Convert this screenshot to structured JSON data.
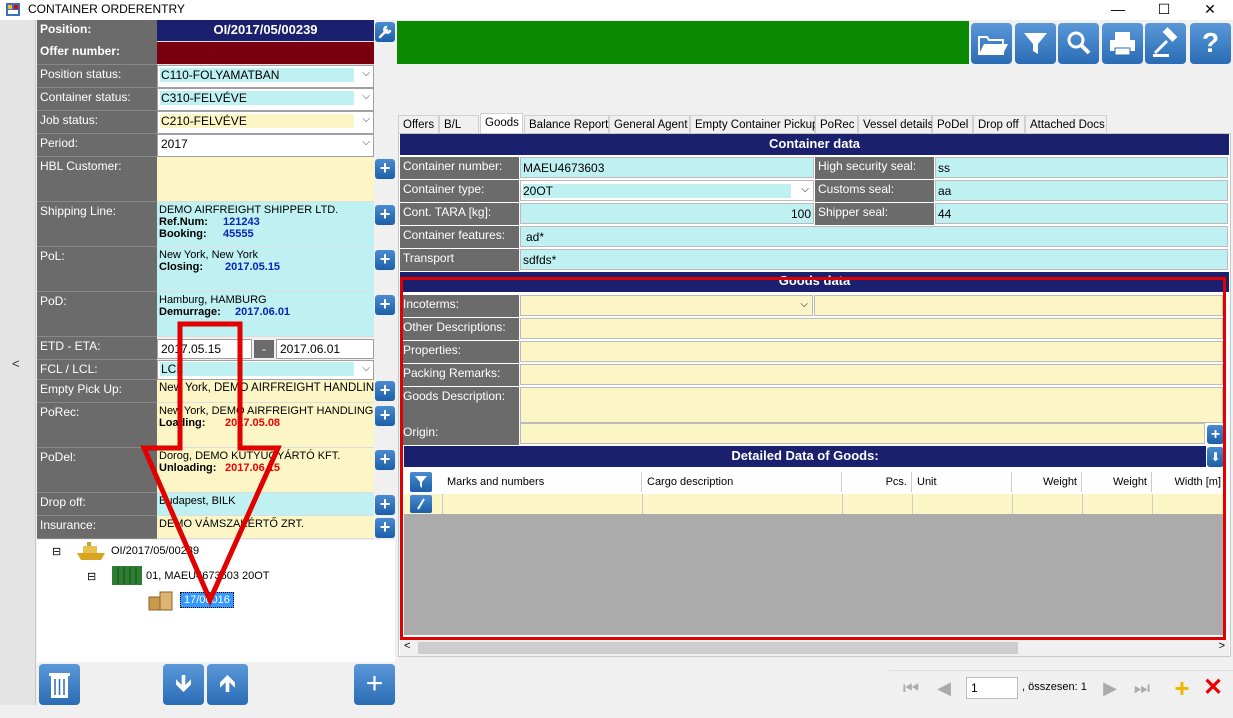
{
  "window": {
    "title": "CONTAINER ORDERENTRY",
    "minimize": "—",
    "maximize": "☐",
    "close": "✕"
  },
  "left": {
    "collapse_label": "<",
    "position_label": "Position:",
    "position_value": "OI/2017/05/00239",
    "offer_label": "Offer number:",
    "position_status_label": "Position status:",
    "position_status_value": "C110-FOLYAMATBAN",
    "container_status_label": "Container status:",
    "container_status_value": "C310-FELVÉVE",
    "job_status_label": "Job status:",
    "job_status_value": "C210-FELVÉVE",
    "period_label": "Period:",
    "period_value": "2017",
    "hbl_label": "HBL Customer:",
    "shipping_line_label": "Shipping Line:",
    "shipping_line_name": "DEMO AIRFREIGHT SHIPPER LTD.",
    "ref_label": "Ref.Num:",
    "ref_value": "121243",
    "booking_label": "Booking:",
    "booking_value": "45555",
    "pol_label": "PoL:",
    "pol_place": "New York, New York",
    "closing_label": "Closing:",
    "closing_value": "2017.05.15",
    "pod_label": "PoD:",
    "pod_place": "Hamburg, HAMBURG",
    "demurrage_label": "Demurrage:",
    "demurrage_value": "2017.06.01",
    "etd_label": "ETD - ETA:",
    "etd_value": "2017.05.15",
    "eta_sep": "-",
    "eta_value": "2017.06.01",
    "fcl_label": "FCL / LCL:",
    "fcl_value": "LCL",
    "empty_pickup_label": "Empty Pick Up:",
    "empty_pickup_value": "New York, DEMO AIRFREIGHT HANDLING A",
    "porec_label": "PoRec:",
    "porec_value": "New York, DEMO AIRFREIGHT HANDLING AG",
    "loading_label": "Loading:",
    "loading_value": "2017.05.08",
    "podel_label": "PoDel:",
    "podel_value": "Dorog, DEMO KÜTYÜGYÁRTÓ KFT.",
    "unloading_label": "Unloading:",
    "unloading_value": "2017.06.15",
    "dropoff_label": "Drop off:",
    "dropoff_value": "Budapest, BILK",
    "insurance_label": "Insurance:",
    "insurance_value": "DEMO VÁMSZAKÉRTŐ ZRT.",
    "tree": {
      "root": "OI/2017/05/00239",
      "child": "01, MAEU4673603 20OT",
      "leaf": "17/00016"
    }
  },
  "tabs": [
    "Offers",
    "B/L",
    "Goods",
    "Balance Report",
    "General Agent",
    "Empty Container Pickup",
    "PoRec",
    "Vessel details",
    "PoDel",
    "Drop off",
    "Attached Docs"
  ],
  "active_tab": "Goods",
  "container": {
    "header": "Container data",
    "number_label": "Container number:",
    "number_value": "MAEU4673603",
    "type_label": "Container type:",
    "type_value": "20OT",
    "tara_label": "Cont. TARA [kg]:",
    "tara_value": "100",
    "features_label": "Container features:",
    "features_value": "ad*",
    "transport_label": "Transport",
    "transport_value": "sdfds*",
    "hs_seal_label": "High security seal:",
    "hs_seal_value": "ss",
    "customs_seal_label": "Customs seal:",
    "customs_seal_value": "aa",
    "shipper_seal_label": "Shipper seal:",
    "shipper_seal_value": "44"
  },
  "goods": {
    "header": "Goods data",
    "incoterms_label": "Incoterms:",
    "other_label": "Other Descriptions:",
    "properties_label": "Properties:",
    "packing_label": "Packing Remarks:",
    "description_label": "Goods Description:",
    "origin_label": "Origin:",
    "detail_header": "Detailed Data of Goods:",
    "columns": [
      "Marks and numbers",
      "Cargo description",
      "Pcs.",
      "Unit",
      "Weight",
      "Weight",
      "Width [m]"
    ]
  },
  "pager": {
    "page": "1",
    "total_label": ", összesen: 1"
  },
  "colors": {
    "accent_red": "#e00000",
    "header_navy": "#1a1f6e",
    "toolbar_green": "#0a8a00",
    "cyan": "#bff0f2",
    "yellow": "#fcf6c6"
  }
}
